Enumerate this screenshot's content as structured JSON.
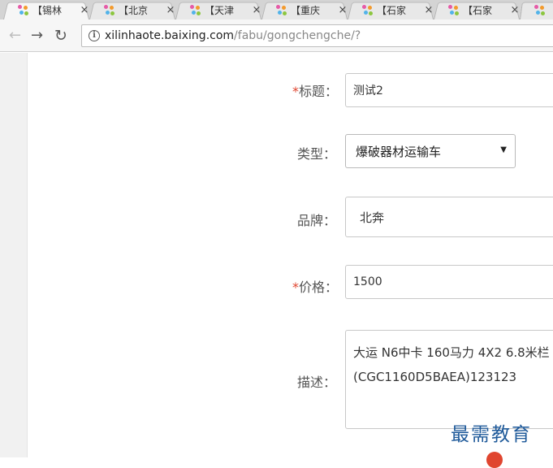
{
  "browser": {
    "tabs": [
      {
        "title": "【锡林",
        "active": true
      },
      {
        "title": "【北京",
        "active": false
      },
      {
        "title": "【天津",
        "active": false
      },
      {
        "title": "【重庆",
        "active": false
      },
      {
        "title": "【石家",
        "active": false
      },
      {
        "title": "【石家",
        "active": false
      },
      {
        "title": "",
        "active": false
      }
    ],
    "close_glyph": "×",
    "url_host": "xilinhaote.baixing.com",
    "url_path": "/fabu/gongchengche/?"
  },
  "form": {
    "title": {
      "required_mark": "*",
      "label": "标题：",
      "value": "测试2"
    },
    "type": {
      "label": "类型：",
      "selected": "爆破器材运输车"
    },
    "brand": {
      "label": "品牌：",
      "value": "北奔"
    },
    "price": {
      "required_mark": "*",
      "label": "价格：",
      "value": "1500"
    },
    "description": {
      "label": "描述：",
      "line1": "大运 N6中卡 160马力 4X2 6.8米栏",
      "line2": "(CGC1160D5BAEA)123123"
    }
  },
  "watermark": "最需教育",
  "icons": {
    "back": "arrow-left-icon",
    "forward": "arrow-right-icon",
    "reload": "reload-icon",
    "site_info": "info-icon",
    "dropdown": "triangle-down-icon",
    "favicon": "baixing-favicon-icon"
  }
}
